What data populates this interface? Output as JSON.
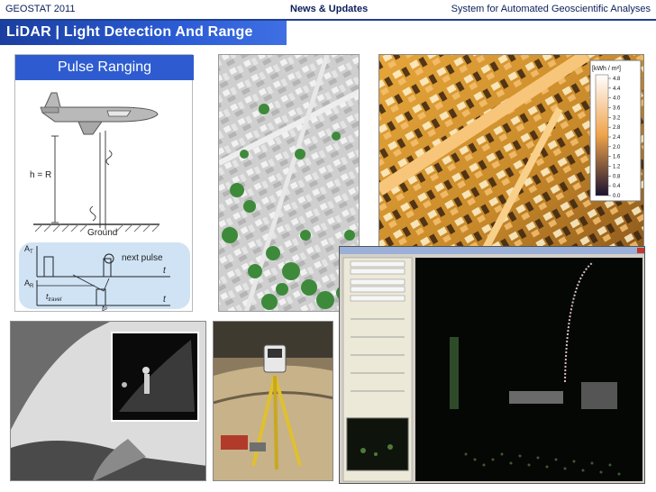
{
  "header": {
    "left_text": "GEOSTAT 2011",
    "center_text": "News & Updates",
    "right_text": "System for Automated Geoscientific Analyses"
  },
  "banner": {
    "title": "LiDAR | Light Detection And Range"
  },
  "pulse_panel": {
    "title": "Pulse Ranging",
    "h_label": "h = R",
    "ground_label": "Ground",
    "next_pulse_label": "next pulse",
    "at_label": "A",
    "at_sub": "T",
    "ar_label": "A",
    "ar_sub": "R",
    "t_label": "t",
    "t2_label": "t",
    "travel_label": "t",
    "travel_sub": "travel",
    "tp_label": "t",
    "tp_sub": "p"
  },
  "solar_legend": {
    "unit": "[kWh / m²]",
    "ticks": [
      "4.8",
      "4.4",
      "4.0",
      "3.6",
      "3.2",
      "2.8",
      "2.4",
      "2.0",
      "1.6",
      "1.2",
      "0.8",
      "0.4",
      "0.0"
    ]
  },
  "colors": {
    "banner": "#2a5bd4",
    "header_text": "#0b1f5c",
    "pulse_title_bg": "#2e5cd0"
  }
}
